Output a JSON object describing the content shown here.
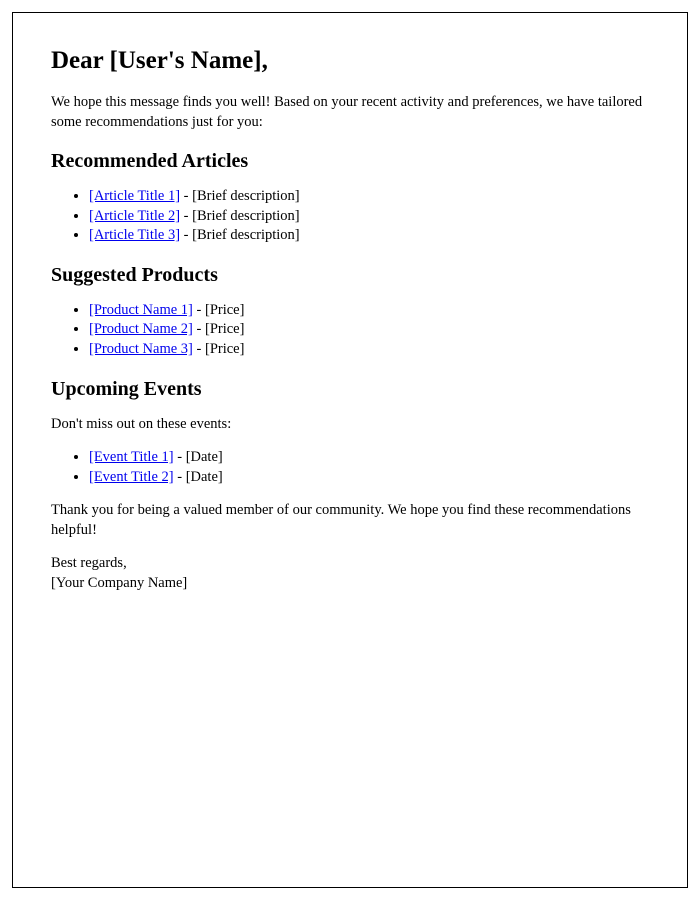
{
  "greeting": "Dear [User's Name],",
  "intro": "We hope this message finds you well! Based on your recent activity and preferences, we have tailored some recommendations just for you:",
  "articles_heading": "Recommended Articles",
  "articles": [
    {
      "title": "[Article Title 1]",
      "desc": "[Brief description]"
    },
    {
      "title": "[Article Title 2]",
      "desc": "[Brief description]"
    },
    {
      "title": "[Article Title 3]",
      "desc": "[Brief description]"
    }
  ],
  "products_heading": "Suggested Products",
  "products": [
    {
      "name": "[Product Name 1]",
      "price": "[Price]"
    },
    {
      "name": "[Product Name 2]",
      "price": "[Price]"
    },
    {
      "name": "[Product Name 3]",
      "price": "[Price]"
    }
  ],
  "events_heading": "Upcoming Events",
  "events_intro": "Don't miss out on these events:",
  "events": [
    {
      "title": "[Event Title 1]",
      "date": "[Date]"
    },
    {
      "title": "[Event Title 2]",
      "date": "[Date]"
    }
  ],
  "thanks": "Thank you for being a valued member of our community. We hope you find these recommendations helpful!",
  "signoff_line1": "Best regards,",
  "signoff_line2": "[Your Company Name]",
  "sep": " - "
}
